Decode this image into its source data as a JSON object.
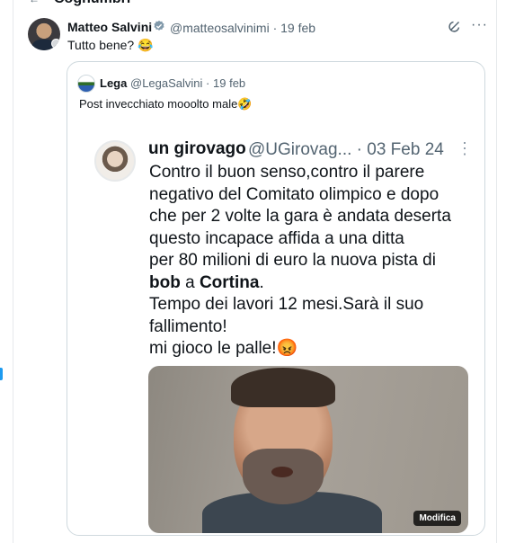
{
  "header": {
    "cut_title": "Cognumbri"
  },
  "post": {
    "author_name": "Matteo Salvini",
    "author_handle": "@matteosalvinimi",
    "separator": "·",
    "date": "19 feb",
    "text": "Tutto bene? 😂",
    "verified_icon": "verified-badge-icon",
    "grok_icon": "grok-icon",
    "more_icon": "more-icon",
    "more_label": "···"
  },
  "quote": {
    "author_name": "Lega",
    "author_handle": "@LegaSalvini",
    "date": "19 feb",
    "text": "Post invecchiato mooolto male🤣"
  },
  "embedded": {
    "author_name": "un girovago",
    "author_handle": "@UGirovag...",
    "date": "03 Feb 24",
    "more_label": "⋮",
    "lines": [
      "Contro il buon senso,contro il parere",
      "negativo del Comitato olimpico e dopo",
      "che per 2 volte la gara è andata deserta",
      "questo incapace  affida a una ditta",
      "per 80 milioni di euro la nuova pista di"
    ],
    "bold_line": {
      "word1": "bob",
      "mid": " a ",
      "word2": "Cortina",
      "end": "."
    },
    "lines2": [
      "Tempo dei lavori 12 mesi.Sarà il suo",
      "fallimento!",
      "mi gioco le palle!😡"
    ],
    "image_badge": "Modifica"
  },
  "colors": {
    "accent": "#1d9bf0",
    "muted": "#536471",
    "border": "#cfd9de"
  }
}
